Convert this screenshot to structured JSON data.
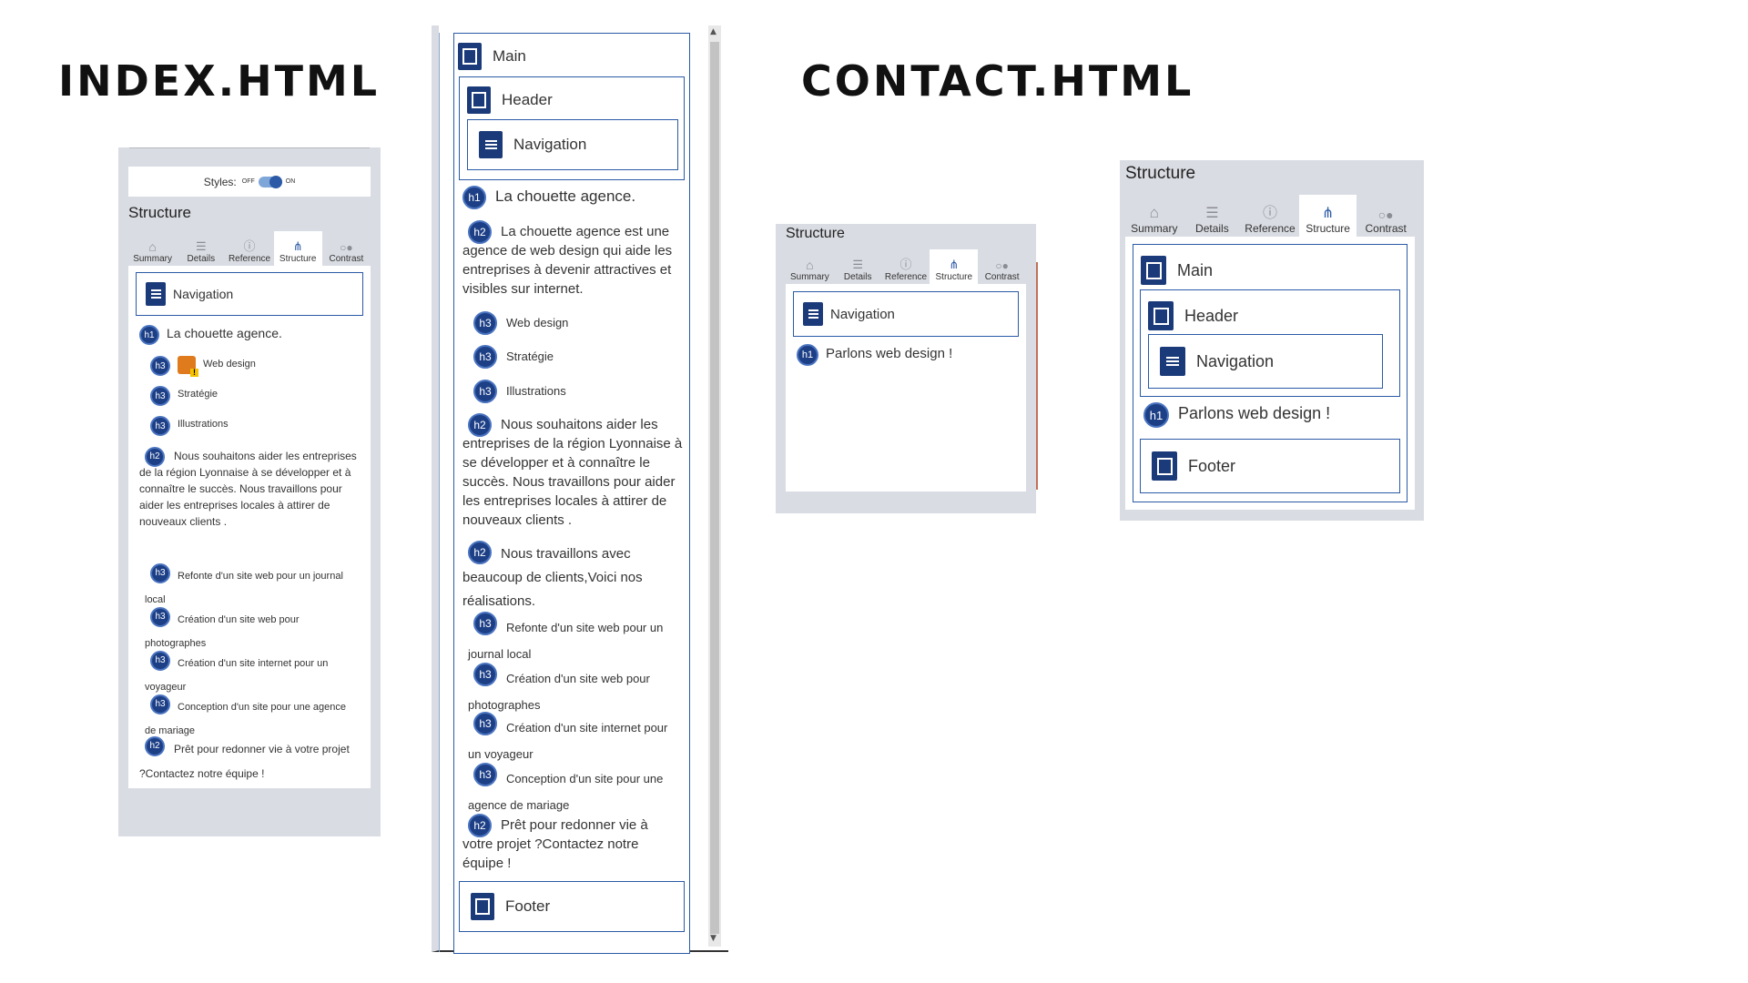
{
  "titles": {
    "index": "INDEX.HTML",
    "contact": "CONTACT.HTML"
  },
  "tabs": [
    "Summary",
    "Details",
    "Reference",
    "Structure",
    "Contrast"
  ],
  "tab_icons": [
    "home-icon",
    "list-icon",
    "info-icon",
    "structure-icon",
    "contrast-icon"
  ],
  "styles_toggle": {
    "label": "Styles:",
    "off": "OFF",
    "on": "ON"
  },
  "section_title": "Structure",
  "landmarks": {
    "main": "Main",
    "header": "Header",
    "navigation": "Navigation",
    "footer": "Footer"
  },
  "heading_levels": {
    "h1": "h1",
    "h2": "h2",
    "h3": "h3"
  },
  "index_small": {
    "h1": "La chouette agence.",
    "h3_a": "Web design",
    "h3_b": "Stratégie",
    "h3_c": "Illustrations",
    "h2_a": "Nous souhaitons aider les entreprises de la région Lyonnaise à se développer et à connaître le succès. Nous travaillons pour aider les entreprises locales à attirer de nouveaux clients .",
    "h3_d": "Refonte d'un site web pour un journal local",
    "h3_e": "Création d'un site web pour photographes",
    "h3_f": "Création d'un site internet pour un voyageur",
    "h3_g": "Conception d'un site pour une agence de mariage",
    "h2_b": "Prêt pour redonner vie à votre projet ?Contactez notre équipe !"
  },
  "index_tall": {
    "h1": "La chouette agence.",
    "h2_a": "La chouette agence est une agence de web design qui aide les entreprises à devenir attractives et visibles sur internet.",
    "h3_a": "Web design",
    "h3_b": "Stratégie",
    "h3_c": "Illustrations",
    "h2_b": "Nous souhaitons aider les entreprises de la région Lyonnaise à se développer et à connaître le succès. Nous travaillons pour aider les entreprises locales à attirer de nouveaux clients .",
    "h2_c": "Nous travaillons avec beaucoup de clients,Voici nos réalisations.",
    "h3_d": "Refonte d'un site web pour un journal local",
    "h3_e": "Création d'un site web pour photographes",
    "h3_f": "Création d'un site internet pour un voyageur",
    "h3_g": "Conception d'un site pour une agence de mariage",
    "h2_d": "Prêt pour redonner vie à votre projet ?Contactez notre équipe !"
  },
  "contact": {
    "h1": "Parlons web design !"
  },
  "colors": {
    "badge": "#1d3f86",
    "landmark_border": "#2a5aa6",
    "panel_bg": "#d9dce2",
    "accent": "#2d5aa7"
  }
}
